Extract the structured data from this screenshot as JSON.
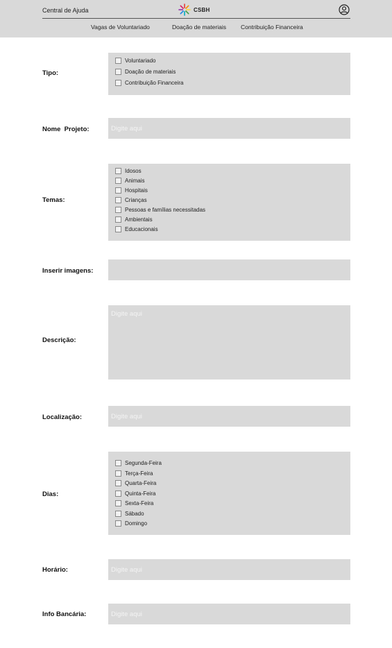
{
  "header": {
    "help_link": "Central de Ajuda",
    "logo_text": "CSBH",
    "nav": [
      "Vagas de Voluntariado",
      "Doação de materiais",
      "Contribuição Financeira"
    ]
  },
  "form": {
    "tipo": {
      "label": "Tipo:",
      "options": [
        "Voluntariado",
        "Doação de materiais",
        "Contribuição Financeira"
      ]
    },
    "nome_projeto": {
      "label": "Nome  Projeto:",
      "placeholder": "Digite aqui"
    },
    "temas": {
      "label": "Temas:",
      "options": [
        "Idosos",
        "Animais",
        "Hospitais",
        "Crianças",
        "Pessoas e famílias necessitadas",
        "Ambientais",
        "Educacionais"
      ]
    },
    "imagens": {
      "label": "Inserir imagens:"
    },
    "descricao": {
      "label": "Descrição:",
      "placeholder": "Digite aqui"
    },
    "localizacao": {
      "label": "Localização:",
      "placeholder": "Digite aqui"
    },
    "dias": {
      "label": "Dias:",
      "options": [
        "Segunda-Feira",
        "Terça-Feira",
        "Quarta-Feira",
        "Quinta-Feira",
        "Sexta-Feira",
        "Sábado",
        "Domingo"
      ]
    },
    "horario": {
      "label": "Horário:",
      "placeholder": "Digite aqui"
    },
    "info_bancaria": {
      "label": "Info Bancária:",
      "placeholder": "Digite aqui"
    }
  }
}
